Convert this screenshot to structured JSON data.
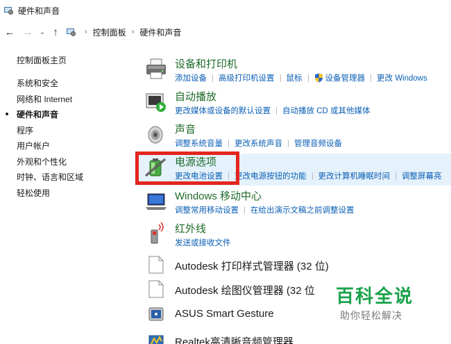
{
  "window": {
    "title": "硬件和声音"
  },
  "nav": {
    "back": "←",
    "forward": "→",
    "dropdown": "⌄",
    "up": "↑",
    "breadcrumb": [
      "控制面板",
      "硬件和声音"
    ]
  },
  "sidebar": {
    "home": "控制面板主页",
    "items": [
      "系统和安全",
      "网络和 Internet",
      "硬件和声音",
      "程序",
      "用户帐户",
      "外观和个性化",
      "时钟、语言和区域",
      "轻松使用"
    ],
    "active_index": 2
  },
  "categories": [
    {
      "title": "设备和打印机",
      "icon": "printer-icon",
      "links": [
        "添加设备",
        "高级打印机设置",
        "鼠标",
        "设备管理器",
        "更改 Windows"
      ]
    },
    {
      "title": "自动播放",
      "icon": "autoplay-icon",
      "links": [
        "更改媒体或设备的默认设置",
        "自动播放 CD 或其他媒体"
      ]
    },
    {
      "title": "声音",
      "icon": "speaker-icon",
      "links": [
        "调整系统音量",
        "更改系统声音",
        "管理音频设备"
      ]
    },
    {
      "title": "电源选项",
      "icon": "battery-icon",
      "links": [
        "更改电池设置",
        "更改电源按钮的功能",
        "更改计算机睡眠时间",
        "调整屏幕亮"
      ]
    },
    {
      "title": "Windows 移动中心",
      "icon": "mobility-center-icon",
      "links": [
        "调整常用移动设置",
        "在给出演示文稿之前调整设置"
      ]
    },
    {
      "title": "红外线",
      "icon": "infrared-icon",
      "links": [
        "发送或接收文件"
      ]
    }
  ],
  "programs": [
    {
      "title": "Autodesk 打印样式管理器 (32 位)",
      "icon": "document-icon"
    },
    {
      "title": "Autodesk 绘图仪管理器 (32 位",
      "icon": "document-icon"
    },
    {
      "title": "ASUS Smart Gesture",
      "icon": "touchpad-icon"
    },
    {
      "title": "Realtek高清晰音频管理器",
      "icon": "realtek-icon"
    }
  ],
  "watermark": {
    "big": "百科全说",
    "small": "助你轻松解决"
  },
  "colors": {
    "link": "#0a5fb4",
    "category_title": "#1e6b29",
    "highlight": "#e5f1fb",
    "annotation_box": "#e4261e",
    "watermark": "#19a24a"
  }
}
